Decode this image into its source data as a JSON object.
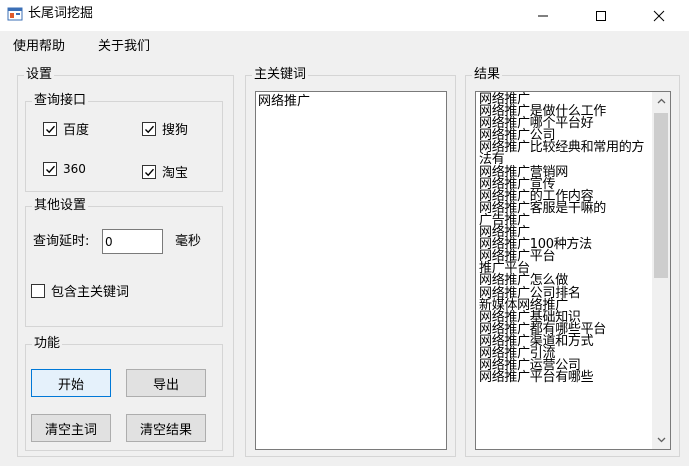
{
  "window": {
    "title": "长尾词挖掘"
  },
  "menu": {
    "items": [
      {
        "label": "使用帮助"
      },
      {
        "label": "关于我们"
      }
    ]
  },
  "settings": {
    "title": "设置",
    "query_group": {
      "title": "查询接口",
      "options": [
        {
          "label": "百度",
          "checked": true
        },
        {
          "label": "搜狗",
          "checked": true
        },
        {
          "label": "360",
          "checked": true
        },
        {
          "label": "淘宝",
          "checked": true
        }
      ]
    },
    "other_group": {
      "title": "其他设置",
      "delay_label": "查询延时:",
      "delay_value": "0",
      "delay_unit": "毫秒",
      "include_main_label": "包含主关键词",
      "include_main_checked": false
    },
    "function_group": {
      "title": "功能",
      "start_label": "开始",
      "export_label": "导出",
      "clear_main_label": "清空主词",
      "clear_result_label": "清空结果"
    }
  },
  "main_keyword": {
    "title": "主关键词",
    "value": "网络推广"
  },
  "results": {
    "title": "结果",
    "lines": [
      "网络推广",
      "网络推广是做什么工作",
      "网络推广哪个平台好",
      "网络推广公司",
      "网络推广比较经典和常用的方法有",
      "网络推广营销网",
      "网络推广宣传",
      "网络推广的工作内容",
      "网络推广客服是干嘛的",
      "广告推广",
      "网络推广",
      "网络推广100种方法",
      "网络推广平台",
      "推广平台",
      "网络推广怎么做",
      "网络推广公司排名",
      "新媒体网络推广",
      "网络推广基础知识",
      "网络推广都有哪些平台",
      "网络推广渠道和方式",
      "网络推广引流",
      "网络推广运营公司",
      "网络推广平台有哪些"
    ]
  }
}
